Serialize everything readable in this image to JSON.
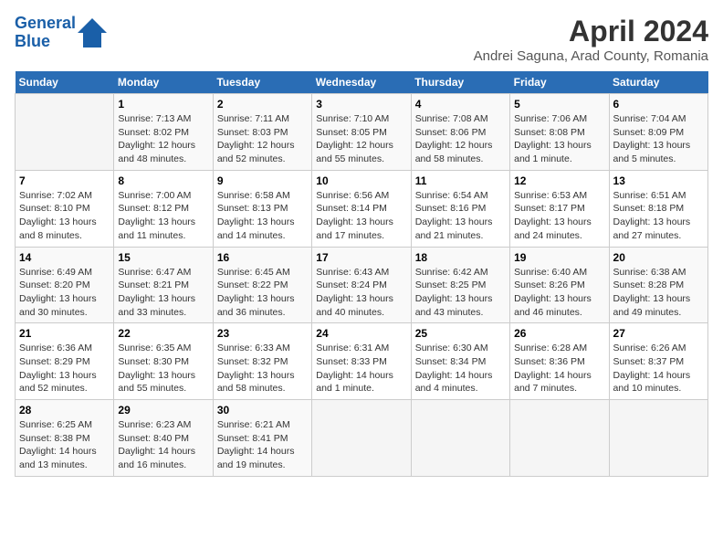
{
  "header": {
    "logo_line1": "General",
    "logo_line2": "Blue",
    "title": "April 2024",
    "subtitle": "Andrei Saguna, Arad County, Romania"
  },
  "weekdays": [
    "Sunday",
    "Monday",
    "Tuesday",
    "Wednesday",
    "Thursday",
    "Friday",
    "Saturday"
  ],
  "weeks": [
    [
      {
        "day": "",
        "info": ""
      },
      {
        "day": "1",
        "info": "Sunrise: 7:13 AM\nSunset: 8:02 PM\nDaylight: 12 hours\nand 48 minutes."
      },
      {
        "day": "2",
        "info": "Sunrise: 7:11 AM\nSunset: 8:03 PM\nDaylight: 12 hours\nand 52 minutes."
      },
      {
        "day": "3",
        "info": "Sunrise: 7:10 AM\nSunset: 8:05 PM\nDaylight: 12 hours\nand 55 minutes."
      },
      {
        "day": "4",
        "info": "Sunrise: 7:08 AM\nSunset: 8:06 PM\nDaylight: 12 hours\nand 58 minutes."
      },
      {
        "day": "5",
        "info": "Sunrise: 7:06 AM\nSunset: 8:08 PM\nDaylight: 13 hours\nand 1 minute."
      },
      {
        "day": "6",
        "info": "Sunrise: 7:04 AM\nSunset: 8:09 PM\nDaylight: 13 hours\nand 5 minutes."
      }
    ],
    [
      {
        "day": "7",
        "info": "Sunrise: 7:02 AM\nSunset: 8:10 PM\nDaylight: 13 hours\nand 8 minutes."
      },
      {
        "day": "8",
        "info": "Sunrise: 7:00 AM\nSunset: 8:12 PM\nDaylight: 13 hours\nand 11 minutes."
      },
      {
        "day": "9",
        "info": "Sunrise: 6:58 AM\nSunset: 8:13 PM\nDaylight: 13 hours\nand 14 minutes."
      },
      {
        "day": "10",
        "info": "Sunrise: 6:56 AM\nSunset: 8:14 PM\nDaylight: 13 hours\nand 17 minutes."
      },
      {
        "day": "11",
        "info": "Sunrise: 6:54 AM\nSunset: 8:16 PM\nDaylight: 13 hours\nand 21 minutes."
      },
      {
        "day": "12",
        "info": "Sunrise: 6:53 AM\nSunset: 8:17 PM\nDaylight: 13 hours\nand 24 minutes."
      },
      {
        "day": "13",
        "info": "Sunrise: 6:51 AM\nSunset: 8:18 PM\nDaylight: 13 hours\nand 27 minutes."
      }
    ],
    [
      {
        "day": "14",
        "info": "Sunrise: 6:49 AM\nSunset: 8:20 PM\nDaylight: 13 hours\nand 30 minutes."
      },
      {
        "day": "15",
        "info": "Sunrise: 6:47 AM\nSunset: 8:21 PM\nDaylight: 13 hours\nand 33 minutes."
      },
      {
        "day": "16",
        "info": "Sunrise: 6:45 AM\nSunset: 8:22 PM\nDaylight: 13 hours\nand 36 minutes."
      },
      {
        "day": "17",
        "info": "Sunrise: 6:43 AM\nSunset: 8:24 PM\nDaylight: 13 hours\nand 40 minutes."
      },
      {
        "day": "18",
        "info": "Sunrise: 6:42 AM\nSunset: 8:25 PM\nDaylight: 13 hours\nand 43 minutes."
      },
      {
        "day": "19",
        "info": "Sunrise: 6:40 AM\nSunset: 8:26 PM\nDaylight: 13 hours\nand 46 minutes."
      },
      {
        "day": "20",
        "info": "Sunrise: 6:38 AM\nSunset: 8:28 PM\nDaylight: 13 hours\nand 49 minutes."
      }
    ],
    [
      {
        "day": "21",
        "info": "Sunrise: 6:36 AM\nSunset: 8:29 PM\nDaylight: 13 hours\nand 52 minutes."
      },
      {
        "day": "22",
        "info": "Sunrise: 6:35 AM\nSunset: 8:30 PM\nDaylight: 13 hours\nand 55 minutes."
      },
      {
        "day": "23",
        "info": "Sunrise: 6:33 AM\nSunset: 8:32 PM\nDaylight: 13 hours\nand 58 minutes."
      },
      {
        "day": "24",
        "info": "Sunrise: 6:31 AM\nSunset: 8:33 PM\nDaylight: 14 hours\nand 1 minute."
      },
      {
        "day": "25",
        "info": "Sunrise: 6:30 AM\nSunset: 8:34 PM\nDaylight: 14 hours\nand 4 minutes."
      },
      {
        "day": "26",
        "info": "Sunrise: 6:28 AM\nSunset: 8:36 PM\nDaylight: 14 hours\nand 7 minutes."
      },
      {
        "day": "27",
        "info": "Sunrise: 6:26 AM\nSunset: 8:37 PM\nDaylight: 14 hours\nand 10 minutes."
      }
    ],
    [
      {
        "day": "28",
        "info": "Sunrise: 6:25 AM\nSunset: 8:38 PM\nDaylight: 14 hours\nand 13 minutes."
      },
      {
        "day": "29",
        "info": "Sunrise: 6:23 AM\nSunset: 8:40 PM\nDaylight: 14 hours\nand 16 minutes."
      },
      {
        "day": "30",
        "info": "Sunrise: 6:21 AM\nSunset: 8:41 PM\nDaylight: 14 hours\nand 19 minutes."
      },
      {
        "day": "",
        "info": ""
      },
      {
        "day": "",
        "info": ""
      },
      {
        "day": "",
        "info": ""
      },
      {
        "day": "",
        "info": ""
      }
    ]
  ]
}
